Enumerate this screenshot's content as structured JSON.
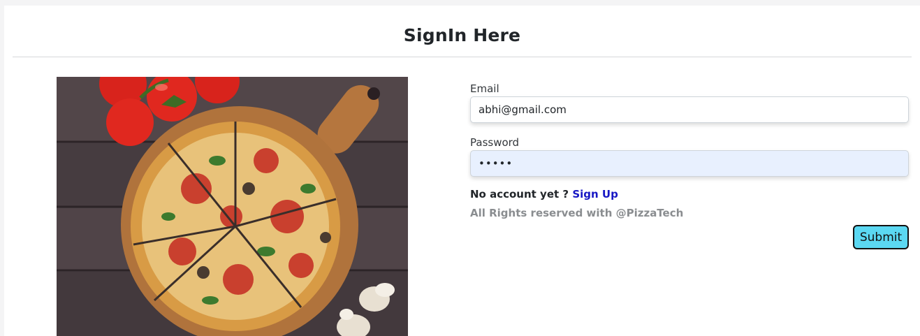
{
  "page": {
    "title": "SignIn Here"
  },
  "form": {
    "email_label": "Email",
    "email_value": "abhi@gmail.com",
    "password_label": "Password",
    "password_value": "•••••",
    "no_account_text": "No account yet ?",
    "signup_link": "Sign Up",
    "rights_text": "All Rights reserved with @PizzaTech",
    "submit_label": "Submit"
  },
  "colors": {
    "submit_bg": "#5bd8f2",
    "link": "#1717c4",
    "password_bg": "#e8f0fe"
  }
}
